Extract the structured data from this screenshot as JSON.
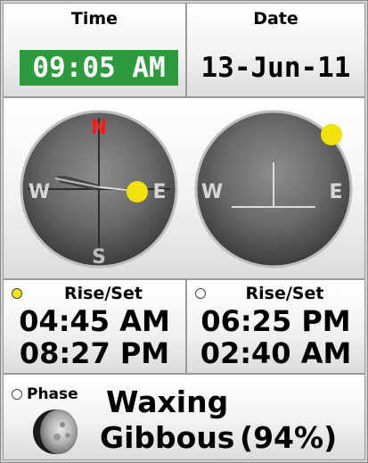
{
  "time": {
    "header": "Time",
    "value": "09:05 AM"
  },
  "date": {
    "header": "Date",
    "value": "13-Jun-11"
  },
  "compass": {
    "n": "N",
    "s": "S",
    "e": "E",
    "w": "W"
  },
  "horizon": {
    "w": "W",
    "e": "E"
  },
  "sun": {
    "header": "Rise/Set",
    "rise": "04:45 AM",
    "set": "08:27 PM"
  },
  "moon": {
    "header": "Rise/Set",
    "rise": "06:25 PM",
    "set": "02:40 AM"
  },
  "phase": {
    "label": "Phase",
    "line1": "Waxing",
    "line2": "Gibbous",
    "percent": "(94%)"
  },
  "colors": {
    "time_highlight": "#2e9a3e",
    "north": "#ff1a1a",
    "sun": "#f2e20c"
  }
}
